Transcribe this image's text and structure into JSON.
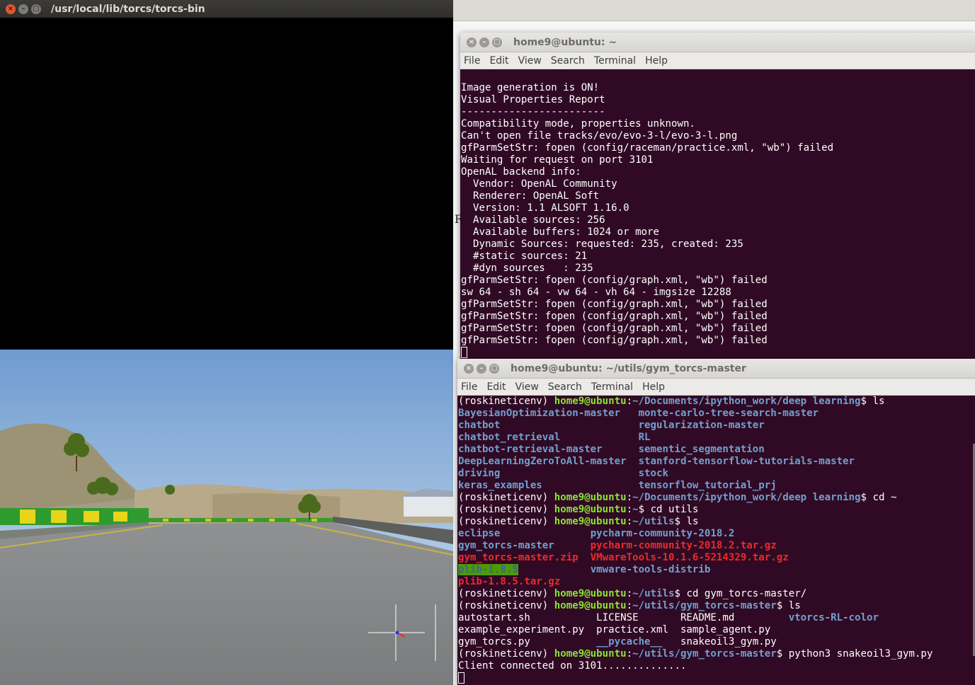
{
  "torcs": {
    "title": "/usr/local/lib/torcs/torcs-bin"
  },
  "terminal1": {
    "title": "home9@ubuntu: ~",
    "menu": [
      "File",
      "Edit",
      "View",
      "Search",
      "Terminal",
      "Help"
    ],
    "lines": [
      "",
      "Image generation is ON!",
      "Visual Properties Report",
      "------------------------",
      "Compatibility mode, properties unknown.",
      "Can't open file tracks/evo/evo-3-l/evo-3-l.png",
      "gfParmSetStr: fopen (config/raceman/practice.xml, \"wb\") failed",
      "Waiting for request on port 3101",
      "OpenAL backend info:",
      "  Vendor: OpenAL Community",
      "  Renderer: OpenAL Soft",
      "  Version: 1.1 ALSOFT 1.16.0",
      "  Available sources: 256",
      "  Available buffers: 1024 or more",
      "  Dynamic Sources: requested: 235, created: 235",
      "  #static sources: 21",
      "  #dyn sources   : 235",
      "gfParmSetStr: fopen (config/graph.xml, \"wb\") failed",
      "sw 64 - sh 64 - vw 64 - vh 64 - imgsize 12288",
      "gfParmSetStr: fopen (config/graph.xml, \"wb\") failed",
      "gfParmSetStr: fopen (config/graph.xml, \"wb\") failed",
      "gfParmSetStr: fopen (config/graph.xml, \"wb\") failed",
      "gfParmSetStr: fopen (config/graph.xml, \"wb\") failed"
    ]
  },
  "terminal2": {
    "title": "home9@ubuntu: ~/utils/gym_torcs-master",
    "menu": [
      "File",
      "Edit",
      "View",
      "Search",
      "Terminal",
      "Help"
    ],
    "lines": [
      [
        [
          "",
          "(roskineticenv) "
        ],
        [
          "g",
          "home9@ubuntu"
        ],
        [
          "",
          ":"
        ],
        [
          "b",
          "~/Documents/ipython_work/deep learning"
        ],
        [
          "",
          "$ ls"
        ]
      ],
      [
        [
          "b",
          "BayesianOptimization-master   "
        ],
        [
          "b",
          "monte-carlo-tree-search-master"
        ]
      ],
      [
        [
          "b",
          "chatbot                       "
        ],
        [
          "b",
          "regularization-master"
        ]
      ],
      [
        [
          "b",
          "chatbot_retrieval             "
        ],
        [
          "b",
          "RL"
        ]
      ],
      [
        [
          "b",
          "chatbot-retrieval-master      "
        ],
        [
          "b",
          "sementic_segmentation"
        ]
      ],
      [
        [
          "b",
          "DeepLearningZeroToAll-master  "
        ],
        [
          "b",
          "stanford-tensorflow-tutorials-master"
        ]
      ],
      [
        [
          "b",
          "driving                       "
        ],
        [
          "b",
          "stock"
        ]
      ],
      [
        [
          "b",
          "keras_examples                "
        ],
        [
          "b",
          "tensorflow_tutorial_prj"
        ]
      ],
      [
        [
          "",
          "(roskineticenv) "
        ],
        [
          "g",
          "home9@ubuntu"
        ],
        [
          "",
          ":"
        ],
        [
          "b",
          "~/Documents/ipython_work/deep learning"
        ],
        [
          "",
          "$ cd ~"
        ]
      ],
      [
        [
          "",
          "(roskineticenv) "
        ],
        [
          "g",
          "home9@ubuntu"
        ],
        [
          "",
          ":"
        ],
        [
          "b",
          "~"
        ],
        [
          "",
          "$ cd utils"
        ]
      ],
      [
        [
          "",
          "(roskineticenv) "
        ],
        [
          "g",
          "home9@ubuntu"
        ],
        [
          "",
          ":"
        ],
        [
          "b",
          "~/utils"
        ],
        [
          "",
          "$ ls"
        ]
      ],
      [
        [
          "b",
          "eclipse"
        ],
        [
          "",
          "               "
        ],
        [
          "b",
          "pycharm-community-2018.2"
        ]
      ],
      [
        [
          "b",
          "gym_torcs-master"
        ],
        [
          "",
          "      "
        ],
        [
          "r",
          "pycharm-community-2018.2.tar.gz"
        ]
      ],
      [
        [
          "r",
          "gym_torcs-master.zip"
        ],
        [
          "",
          "  "
        ],
        [
          "r",
          "VMwareTools-10.1.6-5214329.tar.gz"
        ]
      ],
      [
        [
          "hl",
          "plib-1.8.5"
        ],
        [
          "",
          "            "
        ],
        [
          "b",
          "vmware-tools-distrib"
        ]
      ],
      [
        [
          "r",
          "plib-1.8.5.tar.gz"
        ]
      ],
      [
        [
          "",
          "(roskineticenv) "
        ],
        [
          "g",
          "home9@ubuntu"
        ],
        [
          "",
          ":"
        ],
        [
          "b",
          "~/utils"
        ],
        [
          "",
          "$ cd gym_torcs-master/"
        ]
      ],
      [
        [
          "",
          "(roskineticenv) "
        ],
        [
          "g",
          "home9@ubuntu"
        ],
        [
          "",
          ":"
        ],
        [
          "b",
          "~/utils/gym_torcs-master"
        ],
        [
          "",
          "$ ls"
        ]
      ],
      [
        [
          "",
          "autostart.sh           LICENSE       README.md         "
        ],
        [
          "b",
          "vtorcs-RL-color"
        ]
      ],
      [
        [
          "",
          "example_experiment.py  practice.xml  sample_agent.py"
        ]
      ],
      [
        [
          "",
          "gym_torcs.py           "
        ],
        [
          "b",
          "__pycache__"
        ],
        [
          "",
          "   snakeoil3_gym.py"
        ]
      ],
      [
        [
          "",
          "(roskineticenv) "
        ],
        [
          "g",
          "home9@ubuntu"
        ],
        [
          "",
          ":"
        ],
        [
          "b",
          "~/utils/gym_torcs-master"
        ],
        [
          "",
          "$ python3 snakeoil3_gym.py"
        ]
      ],
      [
        [
          "",
          "Client connected on 3101.............."
        ]
      ]
    ]
  },
  "background": {
    "partial_char": "R"
  },
  "colors": {
    "terminal_bg": "#300a24",
    "prompt_green": "#8ae234",
    "dir_blue": "#729fcf",
    "archive_red": "#ef2929"
  }
}
